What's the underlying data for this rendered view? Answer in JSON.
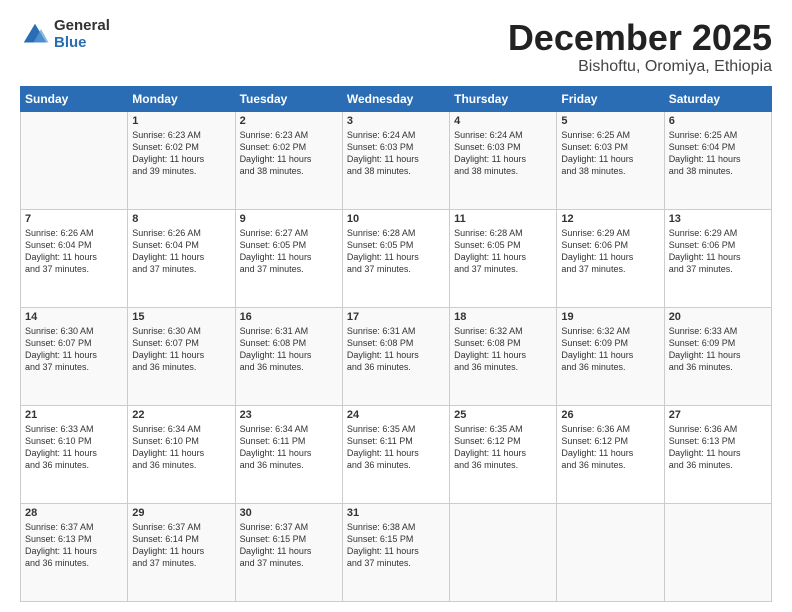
{
  "logo": {
    "general": "General",
    "blue": "Blue"
  },
  "title": "December 2025",
  "subtitle": "Bishoftu, Oromiya, Ethiopia",
  "header_days": [
    "Sunday",
    "Monday",
    "Tuesday",
    "Wednesday",
    "Thursday",
    "Friday",
    "Saturday"
  ],
  "weeks": [
    [
      {
        "day": "",
        "info": ""
      },
      {
        "day": "1",
        "info": "Sunrise: 6:23 AM\nSunset: 6:02 PM\nDaylight: 11 hours\nand 39 minutes."
      },
      {
        "day": "2",
        "info": "Sunrise: 6:23 AM\nSunset: 6:02 PM\nDaylight: 11 hours\nand 38 minutes."
      },
      {
        "day": "3",
        "info": "Sunrise: 6:24 AM\nSunset: 6:03 PM\nDaylight: 11 hours\nand 38 minutes."
      },
      {
        "day": "4",
        "info": "Sunrise: 6:24 AM\nSunset: 6:03 PM\nDaylight: 11 hours\nand 38 minutes."
      },
      {
        "day": "5",
        "info": "Sunrise: 6:25 AM\nSunset: 6:03 PM\nDaylight: 11 hours\nand 38 minutes."
      },
      {
        "day": "6",
        "info": "Sunrise: 6:25 AM\nSunset: 6:04 PM\nDaylight: 11 hours\nand 38 minutes."
      }
    ],
    [
      {
        "day": "7",
        "info": "Sunrise: 6:26 AM\nSunset: 6:04 PM\nDaylight: 11 hours\nand 37 minutes."
      },
      {
        "day": "8",
        "info": "Sunrise: 6:26 AM\nSunset: 6:04 PM\nDaylight: 11 hours\nand 37 minutes."
      },
      {
        "day": "9",
        "info": "Sunrise: 6:27 AM\nSunset: 6:05 PM\nDaylight: 11 hours\nand 37 minutes."
      },
      {
        "day": "10",
        "info": "Sunrise: 6:28 AM\nSunset: 6:05 PM\nDaylight: 11 hours\nand 37 minutes."
      },
      {
        "day": "11",
        "info": "Sunrise: 6:28 AM\nSunset: 6:05 PM\nDaylight: 11 hours\nand 37 minutes."
      },
      {
        "day": "12",
        "info": "Sunrise: 6:29 AM\nSunset: 6:06 PM\nDaylight: 11 hours\nand 37 minutes."
      },
      {
        "day": "13",
        "info": "Sunrise: 6:29 AM\nSunset: 6:06 PM\nDaylight: 11 hours\nand 37 minutes."
      }
    ],
    [
      {
        "day": "14",
        "info": "Sunrise: 6:30 AM\nSunset: 6:07 PM\nDaylight: 11 hours\nand 37 minutes."
      },
      {
        "day": "15",
        "info": "Sunrise: 6:30 AM\nSunset: 6:07 PM\nDaylight: 11 hours\nand 36 minutes."
      },
      {
        "day": "16",
        "info": "Sunrise: 6:31 AM\nSunset: 6:08 PM\nDaylight: 11 hours\nand 36 minutes."
      },
      {
        "day": "17",
        "info": "Sunrise: 6:31 AM\nSunset: 6:08 PM\nDaylight: 11 hours\nand 36 minutes."
      },
      {
        "day": "18",
        "info": "Sunrise: 6:32 AM\nSunset: 6:08 PM\nDaylight: 11 hours\nand 36 minutes."
      },
      {
        "day": "19",
        "info": "Sunrise: 6:32 AM\nSunset: 6:09 PM\nDaylight: 11 hours\nand 36 minutes."
      },
      {
        "day": "20",
        "info": "Sunrise: 6:33 AM\nSunset: 6:09 PM\nDaylight: 11 hours\nand 36 minutes."
      }
    ],
    [
      {
        "day": "21",
        "info": "Sunrise: 6:33 AM\nSunset: 6:10 PM\nDaylight: 11 hours\nand 36 minutes."
      },
      {
        "day": "22",
        "info": "Sunrise: 6:34 AM\nSunset: 6:10 PM\nDaylight: 11 hours\nand 36 minutes."
      },
      {
        "day": "23",
        "info": "Sunrise: 6:34 AM\nSunset: 6:11 PM\nDaylight: 11 hours\nand 36 minutes."
      },
      {
        "day": "24",
        "info": "Sunrise: 6:35 AM\nSunset: 6:11 PM\nDaylight: 11 hours\nand 36 minutes."
      },
      {
        "day": "25",
        "info": "Sunrise: 6:35 AM\nSunset: 6:12 PM\nDaylight: 11 hours\nand 36 minutes."
      },
      {
        "day": "26",
        "info": "Sunrise: 6:36 AM\nSunset: 6:12 PM\nDaylight: 11 hours\nand 36 minutes."
      },
      {
        "day": "27",
        "info": "Sunrise: 6:36 AM\nSunset: 6:13 PM\nDaylight: 11 hours\nand 36 minutes."
      }
    ],
    [
      {
        "day": "28",
        "info": "Sunrise: 6:37 AM\nSunset: 6:13 PM\nDaylight: 11 hours\nand 36 minutes."
      },
      {
        "day": "29",
        "info": "Sunrise: 6:37 AM\nSunset: 6:14 PM\nDaylight: 11 hours\nand 37 minutes."
      },
      {
        "day": "30",
        "info": "Sunrise: 6:37 AM\nSunset: 6:15 PM\nDaylight: 11 hours\nand 37 minutes."
      },
      {
        "day": "31",
        "info": "Sunrise: 6:38 AM\nSunset: 6:15 PM\nDaylight: 11 hours\nand 37 minutes."
      },
      {
        "day": "",
        "info": ""
      },
      {
        "day": "",
        "info": ""
      },
      {
        "day": "",
        "info": ""
      }
    ]
  ]
}
